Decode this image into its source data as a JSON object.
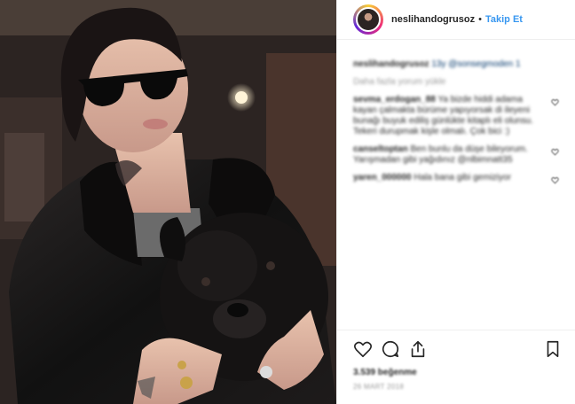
{
  "header": {
    "username": "neslihandogrusoz",
    "separator": "•",
    "follow_label": "Takip Et"
  },
  "comments": [
    {
      "user": "neslihandogrusoz",
      "text": "13y @sonsegmoden 1",
      "liked": false
    },
    {
      "user": "",
      "text": "Daha fazla yorum yükle",
      "liked": false
    },
    {
      "user": "sevma_erdogan_88",
      "text": "Ya bizde hiddi adama kayan çalmakta bürüme yapıyorsak di ileyeni bunağı buyuk ediliş günlükte kitaplı eli olunsu. Tekeri durupmak kişle olmalı. Çok bici :)",
      "liked": true
    },
    {
      "user": "canseltoptan",
      "text": "Ben bunlu da düşe bileyorum. Yarışmadan gibi yağıdınız @nlbimnatt35",
      "liked": true
    },
    {
      "user": "yaren_000000",
      "text": "Hala bana gibi gemiziyor",
      "liked": true
    }
  ],
  "footer": {
    "likes_label": "3.539 beğenme",
    "date_label": "26 MART 2018"
  },
  "icons": [
    "heart-icon",
    "comment-icon",
    "share-icon",
    "bookmark-icon"
  ],
  "colors": {
    "accent": "#3897f0",
    "text": "#262626",
    "muted": "#999999",
    "border": "#efefef"
  }
}
